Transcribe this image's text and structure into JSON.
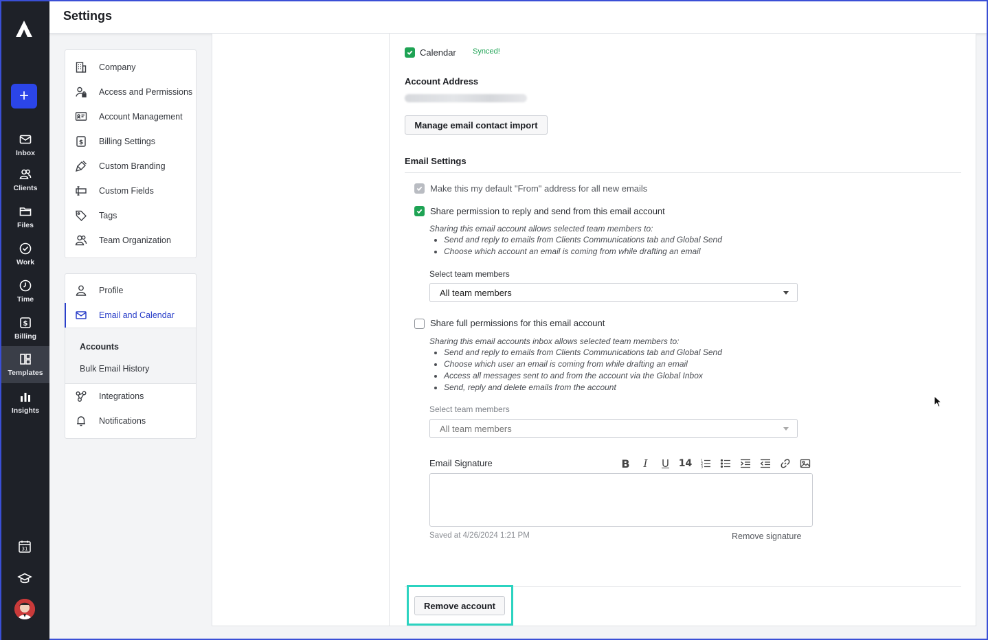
{
  "app": {
    "page_title": "Settings"
  },
  "rail": {
    "items": [
      {
        "label": "Inbox",
        "icon": "inbox-icon"
      },
      {
        "label": "Clients",
        "icon": "clients-icon"
      },
      {
        "label": "Files",
        "icon": "folder-icon"
      },
      {
        "label": "Work",
        "icon": "check-circle-icon"
      },
      {
        "label": "Time",
        "icon": "clock-icon"
      },
      {
        "label": "Billing",
        "icon": "dollar-icon"
      },
      {
        "label": "Templates",
        "icon": "templates-icon"
      },
      {
        "label": "Insights",
        "icon": "bar-chart-icon"
      }
    ],
    "calendar_day": "31"
  },
  "settings_nav": {
    "group1": [
      {
        "label": "Company",
        "icon": "building-icon"
      },
      {
        "label": "Access and Permissions",
        "icon": "user-lock-icon"
      },
      {
        "label": "Account Management",
        "icon": "id-card-icon"
      },
      {
        "label": "Billing Settings",
        "icon": "dollar-doc-icon"
      },
      {
        "label": "Custom Branding",
        "icon": "brush-icon"
      },
      {
        "label": "Custom Fields",
        "icon": "fields-icon"
      },
      {
        "label": "Tags",
        "icon": "tag-icon"
      },
      {
        "label": "Team Organization",
        "icon": "team-icon"
      }
    ],
    "group2": {
      "profile": "Profile",
      "email_calendar": "Email and Calendar",
      "sub_accounts": "Accounts",
      "sub_bulk": "Bulk Email History",
      "integrations": "Integrations",
      "notifications": "Notifications"
    }
  },
  "main": {
    "calendar_label": "Calendar",
    "synced_label": "Synced!",
    "account_address_heading": "Account Address",
    "manage_button": "Manage email contact import",
    "email_settings_heading": "Email Settings",
    "default_from": "Make this my default \"From\" address for all new emails",
    "share_permission": "Share permission to reply and send from this email account",
    "share_permission_desc": "Sharing this email account allows selected team members to:",
    "share_permission_bullets": [
      "Send and reply to emails from Clients Communications tab and Global Send",
      "Choose which account an email is coming from while drafting an email"
    ],
    "select_team_label": "Select team members",
    "select_team_value": "All team members",
    "share_full": "Share full permissions for this email account",
    "share_full_desc": "Sharing this email accounts inbox allows selected team members to:",
    "share_full_bullets": [
      "Send and reply to emails from Clients Communications tab and Global Send",
      "Choose which user an email is coming from while drafting an email",
      "Access all messages sent to and from the account via the Global Inbox",
      "Send, reply and delete emails from the account"
    ],
    "select_team_label2": "Select team members",
    "select_team_value2": "All team members",
    "signature_label": "Email Signature",
    "font_size": "14",
    "saved_at": "Saved at 4/26/2024 1:21 PM",
    "remove_signature": "Remove signature",
    "remove_account": "Remove account"
  }
}
